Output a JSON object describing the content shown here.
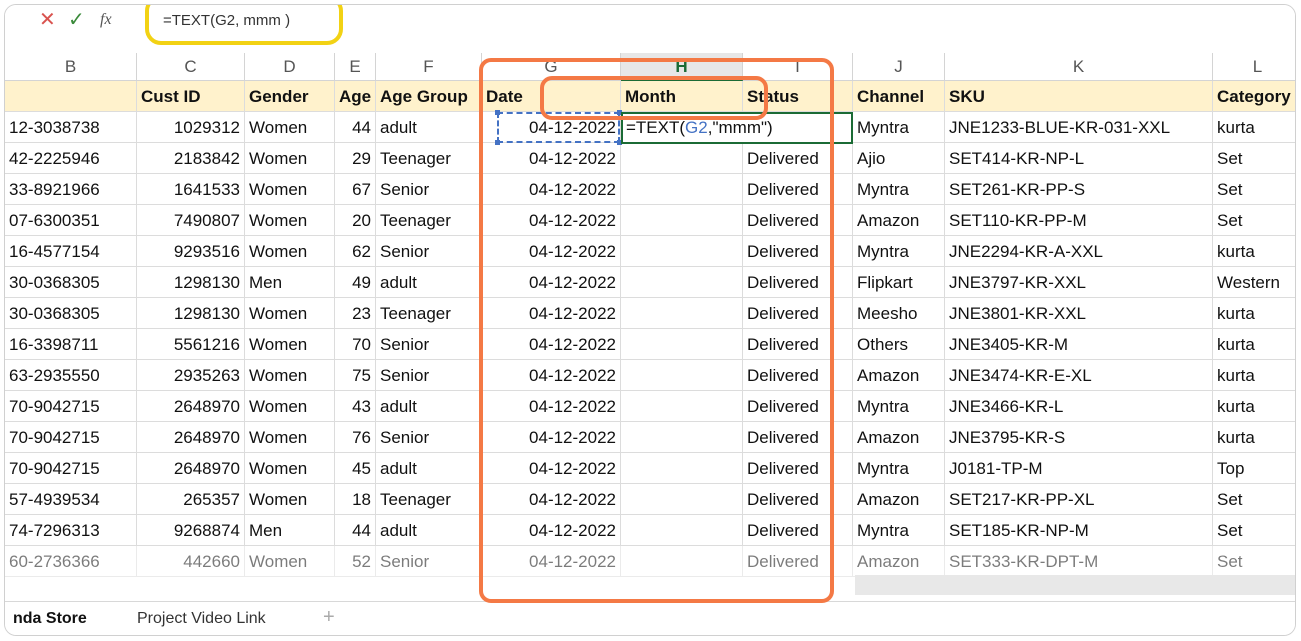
{
  "formula_bar": {
    "cancel_icon": "✕",
    "enter_icon": "✓",
    "fx_icon": "fx",
    "content": "=TEXT(G2, mmm )"
  },
  "columns": [
    "B",
    "C",
    "D",
    "E",
    "F",
    "G",
    "H",
    "I",
    "J",
    "K",
    "L"
  ],
  "selected_column": "H",
  "headers": [
    "",
    "Cust ID",
    "Gender",
    "Age",
    "Age Group",
    "Date",
    "Month",
    "Status",
    "Channel",
    "SKU",
    "Category"
  ],
  "rows": [
    [
      "12-3038738",
      "1029312",
      "Women",
      "44",
      "adult",
      "04-12-2022",
      "",
      "",
      "Myntra",
      "JNE1233-BLUE-KR-031-XXL",
      "kurta"
    ],
    [
      "42-2225946",
      "2183842",
      "Women",
      "29",
      "Teenager",
      "04-12-2022",
      "",
      "Delivered",
      "Ajio",
      "SET414-KR-NP-L",
      "Set"
    ],
    [
      "33-8921966",
      "1641533",
      "Women",
      "67",
      "Senior",
      "04-12-2022",
      "",
      "Delivered",
      "Myntra",
      "SET261-KR-PP-S",
      "Set"
    ],
    [
      "07-6300351",
      "7490807",
      "Women",
      "20",
      "Teenager",
      "04-12-2022",
      "",
      "Delivered",
      "Amazon",
      "SET110-KR-PP-M",
      "Set"
    ],
    [
      "16-4577154",
      "9293516",
      "Women",
      "62",
      "Senior",
      "04-12-2022",
      "",
      "Delivered",
      "Myntra",
      "JNE2294-KR-A-XXL",
      "kurta"
    ],
    [
      "30-0368305",
      "1298130",
      "Men",
      "49",
      "adult",
      "04-12-2022",
      "",
      "Delivered",
      "Flipkart",
      "JNE3797-KR-XXL",
      "Western"
    ],
    [
      "30-0368305",
      "1298130",
      "Women",
      "23",
      "Teenager",
      "04-12-2022",
      "",
      "Delivered",
      "Meesho",
      "JNE3801-KR-XXL",
      "kurta"
    ],
    [
      "16-3398711",
      "5561216",
      "Women",
      "70",
      "Senior",
      "04-12-2022",
      "",
      "Delivered",
      "Others",
      "JNE3405-KR-M",
      "kurta"
    ],
    [
      "63-2935550",
      "2935263",
      "Women",
      "75",
      "Senior",
      "04-12-2022",
      "",
      "Delivered",
      "Amazon",
      "JNE3474-KR-E-XL",
      "kurta"
    ],
    [
      "70-9042715",
      "2648970",
      "Women",
      "43",
      "adult",
      "04-12-2022",
      "",
      "Delivered",
      "Myntra",
      "JNE3466-KR-L",
      "kurta"
    ],
    [
      "70-9042715",
      "2648970",
      "Women",
      "76",
      "Senior",
      "04-12-2022",
      "",
      "Delivered",
      "Amazon",
      "JNE3795-KR-S",
      "kurta"
    ],
    [
      "70-9042715",
      "2648970",
      "Women",
      "45",
      "adult",
      "04-12-2022",
      "",
      "Delivered",
      "Myntra",
      "J0181-TP-M",
      "Top"
    ],
    [
      "57-4939534",
      "265357",
      "Women",
      "18",
      "Teenager",
      "04-12-2022",
      "",
      "Delivered",
      "Amazon",
      "SET217-KR-PP-XL",
      "Set"
    ],
    [
      "74-7296313",
      "9268874",
      "Men",
      "44",
      "adult",
      "04-12-2022",
      "",
      "Delivered",
      "Myntra",
      "SET185-KR-NP-M",
      "Set"
    ],
    [
      "60-2736366",
      "442660",
      "Women",
      "52",
      "Senior",
      "04-12-2022",
      "",
      "Delivered",
      "Amazon",
      "SET333-KR-DPT-M",
      "Set"
    ]
  ],
  "active_cell": {
    "prefix": "=TEXT(",
    "ref": "G2",
    "suffix": ",\"mmm\")"
  },
  "sheet_tabs": [
    "nda Store",
    "Project Video Link"
  ],
  "add_sheet_icon": "+",
  "colors": {
    "header_fill": "#fff2cc",
    "highlight": "#f47945",
    "formula_highlight": "#f2d214",
    "select_green": "#1b6b35",
    "ref_blue": "#4472c4"
  }
}
